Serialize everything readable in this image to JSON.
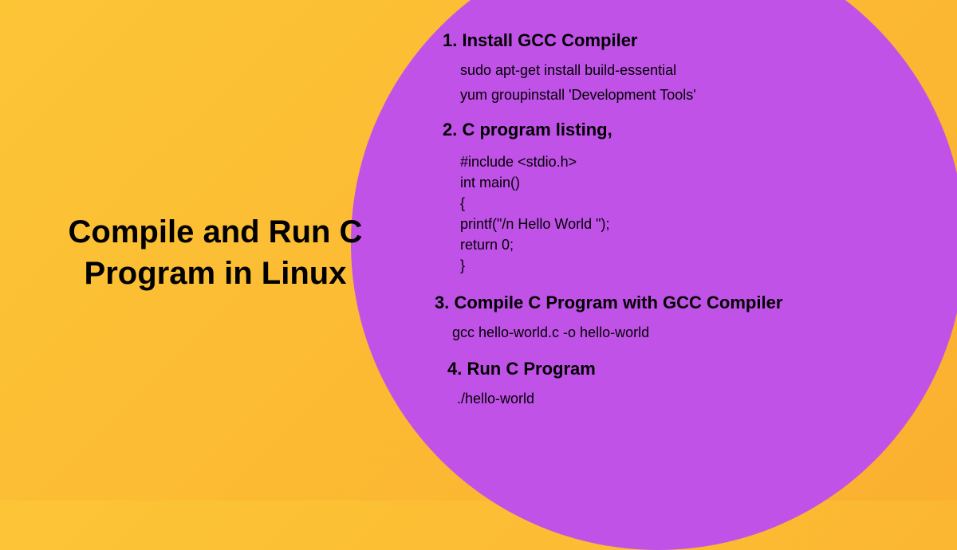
{
  "title": "Compile and Run C Program in Linux",
  "steps": {
    "s1": {
      "heading": "1. Install GCC Compiler",
      "cmd1": "sudo apt-get install build-essential",
      "cmd2": "yum groupinstall 'Development Tools'"
    },
    "s2": {
      "heading": "2. C program listing,",
      "code": "#include <stdio.h>\nint main()\n{\nprintf(\"/n Hello World \");\nreturn 0;\n}"
    },
    "s3": {
      "heading": "3. Compile C Program with GCC Compiler",
      "cmd": "gcc hello-world.c -o hello-world"
    },
    "s4": {
      "heading": "4. Run C Program",
      "cmd": "./hello-world"
    }
  }
}
